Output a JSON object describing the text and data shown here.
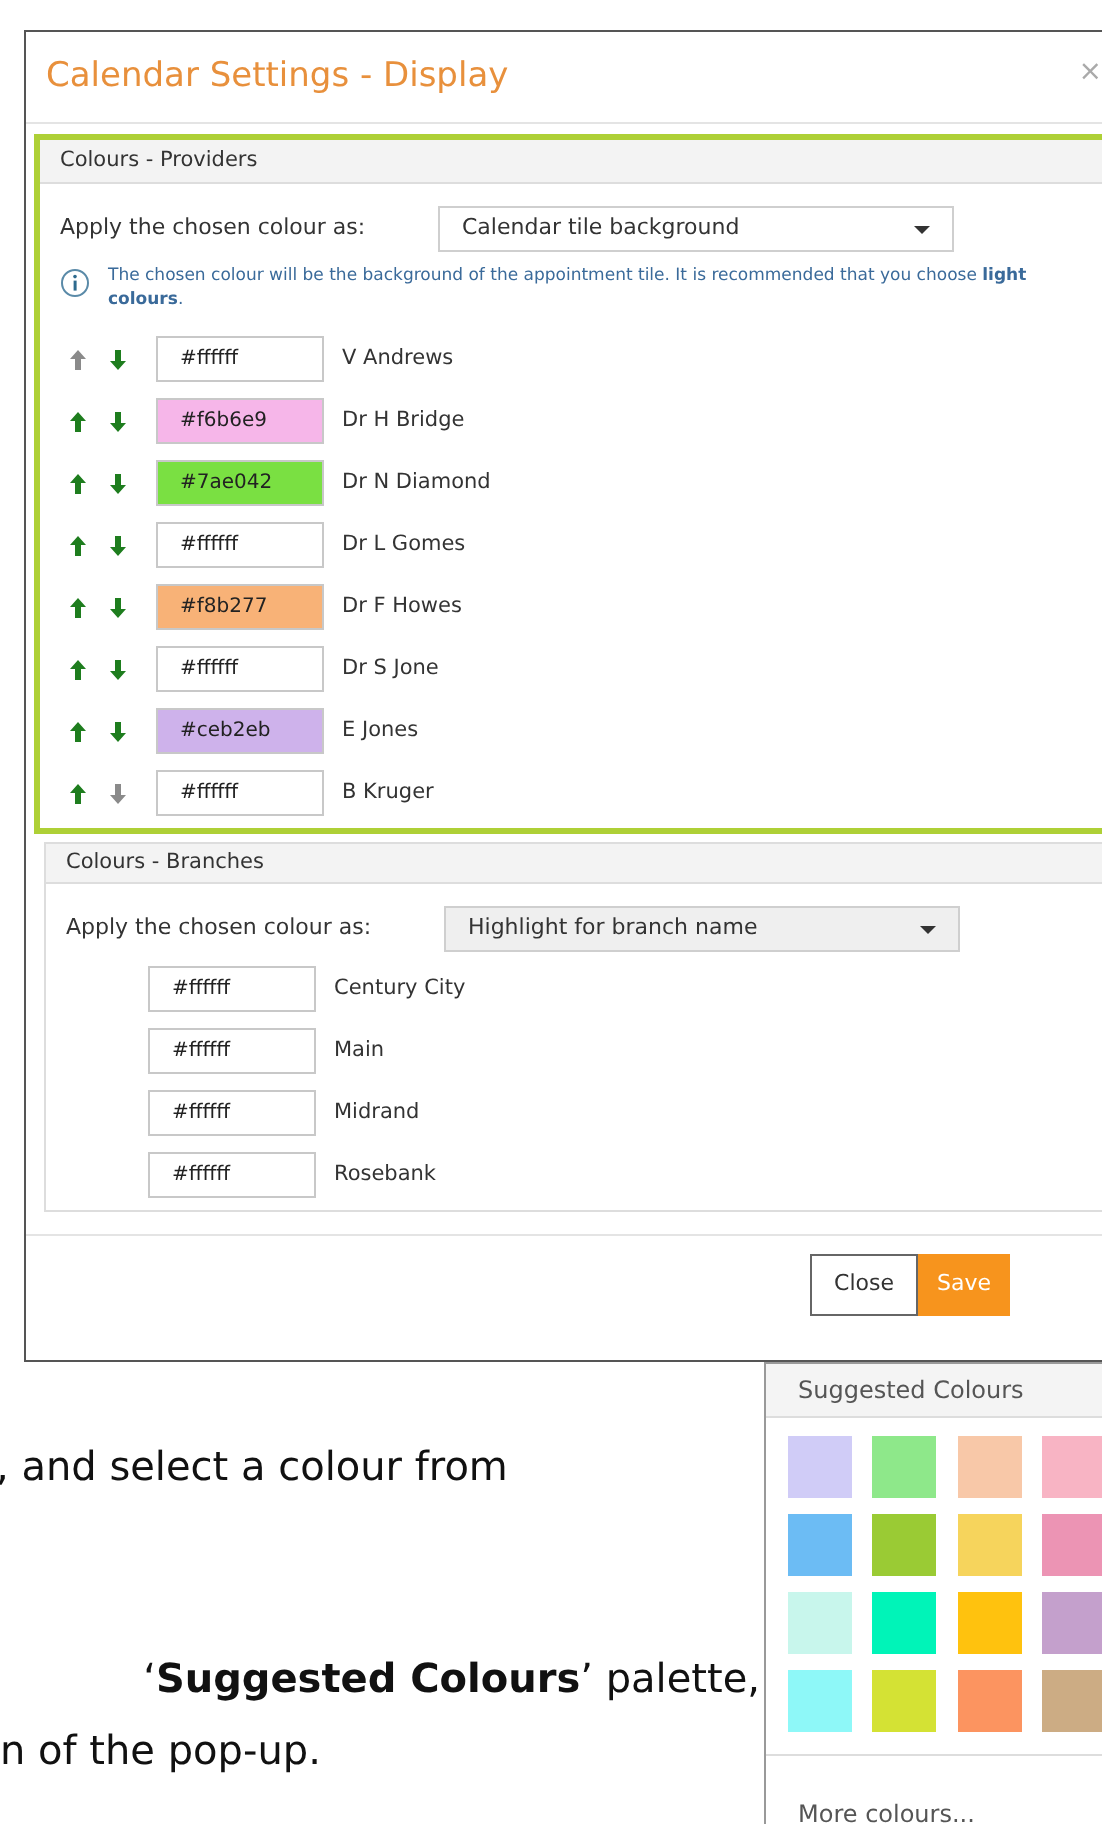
{
  "dialog": {
    "title": "Calendar Settings - Display",
    "close": "×",
    "providers": {
      "heading": "Colours - Providers",
      "apply_label": "Apply the chosen colour as:",
      "apply_value": "Calendar tile background",
      "info": "The chosen colour will be the background of the appointment tile. It is recommended that you choose **light colours**.",
      "rows": [
        {
          "value": "#ffffff",
          "color": "#ffffff",
          "name": "V Andrews",
          "up_enabled": false,
          "down_enabled": true
        },
        {
          "value": "#f6b6e9",
          "color": "#f6b6e9",
          "name": "Dr H Bridge",
          "up_enabled": true,
          "down_enabled": true
        },
        {
          "value": "#7ae042",
          "color": "#7ae042",
          "name": "Dr N Diamond",
          "up_enabled": true,
          "down_enabled": true
        },
        {
          "value": "#ffffff",
          "color": "#ffffff",
          "name": "Dr L Gomes",
          "up_enabled": true,
          "down_enabled": true
        },
        {
          "value": "#f8b277",
          "color": "#f8b277",
          "name": "Dr F Howes",
          "up_enabled": true,
          "down_enabled": true
        },
        {
          "value": "#ffffff",
          "color": "#ffffff",
          "name": "Dr S Jone",
          "up_enabled": true,
          "down_enabled": true
        },
        {
          "value": "#ceb2eb",
          "color": "#ceb2eb",
          "name": "E Jones",
          "up_enabled": true,
          "down_enabled": true
        },
        {
          "value": "#ffffff",
          "color": "#ffffff",
          "name": "B Kruger",
          "up_enabled": true,
          "down_enabled": false
        }
      ]
    },
    "branches": {
      "heading": "Colours - Branches",
      "apply_label": "Apply the chosen colour as:",
      "apply_value": "Highlight for branch name",
      "rows": [
        {
          "value": "#ffffff",
          "color": "#ffffff",
          "name": "Century City"
        },
        {
          "value": "#ffffff",
          "color": "#ffffff",
          "name": "Main"
        },
        {
          "value": "#ffffff",
          "color": "#ffffff",
          "name": "Midrand"
        },
        {
          "value": "#ffffff",
          "color": "#ffffff",
          "name": "Rosebank"
        }
      ]
    },
    "buttons": {
      "close": "Close",
      "save": "Save"
    }
  },
  "document_text": [
    ", and select a colour from",
    "‘**Suggested Colours**’ palette,",
    "n of the pop-up."
  ],
  "palette": {
    "title": "Suggested Colours",
    "swatches": [
      {
        "color": "#d0ccf7"
      },
      {
        "color": "#8ee88a"
      },
      {
        "color": "#f8c8a8"
      },
      {
        "color": "#f8b4c4"
      },
      {
        "color": "#6cbcf4"
      },
      {
        "color": "#9acb34"
      },
      {
        "color": "#f6d45c"
      },
      {
        "color": "#ec94b4"
      },
      {
        "color": "#c8f6ec"
      },
      {
        "color": "#00f4b8"
      },
      {
        "color": "#ffc20e"
      },
      {
        "color": "#c4a0cc"
      },
      {
        "color": "#8ef8f8"
      },
      {
        "color": "#d4e234"
      },
      {
        "color": "#fc9460"
      },
      {
        "color": "#ccac84"
      }
    ],
    "more": "More colours..."
  }
}
